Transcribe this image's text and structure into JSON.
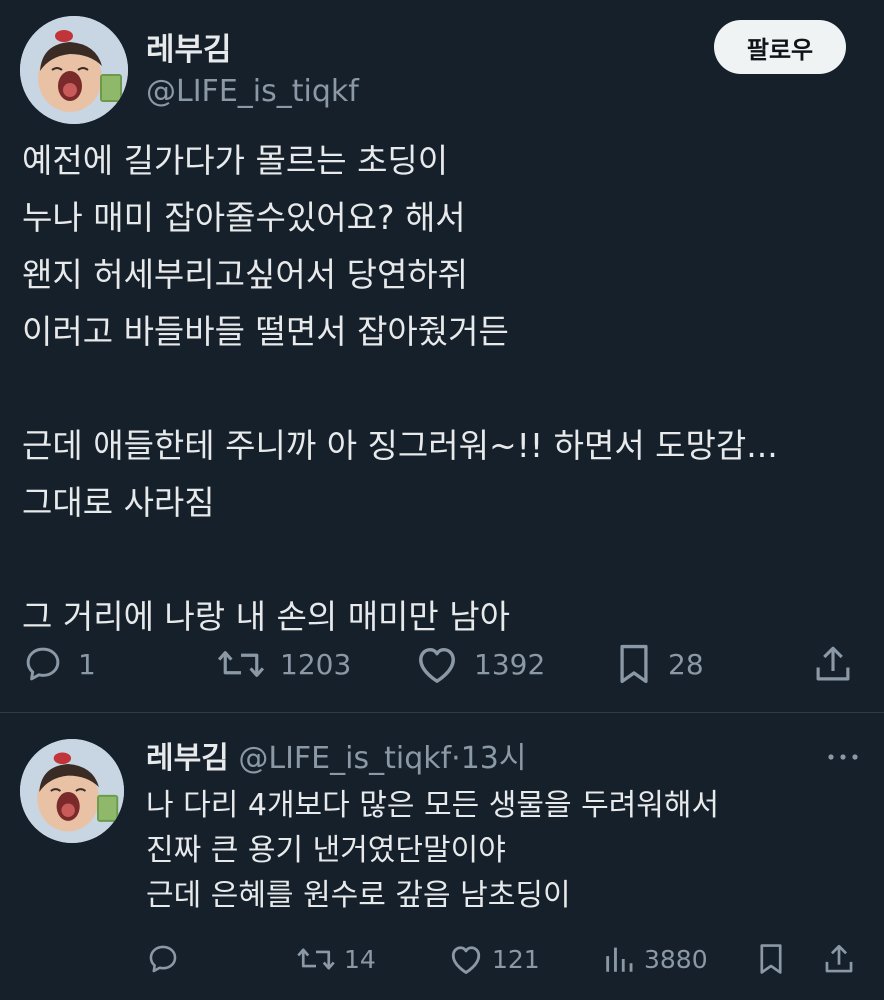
{
  "main_tweet": {
    "display_name": "레부김",
    "handle": "@LIFE_is_tiqkf",
    "follow_label": "팔로우",
    "lines": [
      "예전에 길가다가 몰르는 초딩이",
      "누나 매미 잡아줄수있어요? 해서",
      "왠지 허세부리고싶어서 당연하쥐",
      "이러고 바들바들 떨면서 잡아줬거든",
      "",
      "근데 애들한테 주니까 아 징그러워~!! 하면서 도망감...",
      "그대로 사라짐",
      "",
      "그 거리에 나랑 내 손의 매미만 남아"
    ],
    "actions": {
      "replies": "1",
      "retweets": "1203",
      "likes": "1392",
      "bookmarks": "28"
    }
  },
  "reply_tweet": {
    "display_name": "레부김",
    "handle": "@LIFE_is_tiqkf",
    "separator": "·",
    "time": "13시",
    "lines": [
      "나 다리 4개보다 많은 모든 생물을 두려워해서",
      "진짜 큰 용기 낸거였단말이야",
      "근데 은혜를 원수로 갚음 남초딩이"
    ],
    "actions": {
      "replies": "",
      "retweets": "14",
      "likes": "121",
      "views": "3880"
    }
  },
  "icons": {
    "reply": "speech-bubble-icon",
    "retweet": "retweet-icon",
    "like": "heart-icon",
    "bookmark": "bookmark-icon",
    "share": "share-icon",
    "views": "bar-chart-icon",
    "more": "more-dots-icon"
  },
  "colors": {
    "background": "#15202b",
    "text": "#e7e9ea",
    "muted": "#8b98a5",
    "follow_bg": "#eff3f4"
  }
}
